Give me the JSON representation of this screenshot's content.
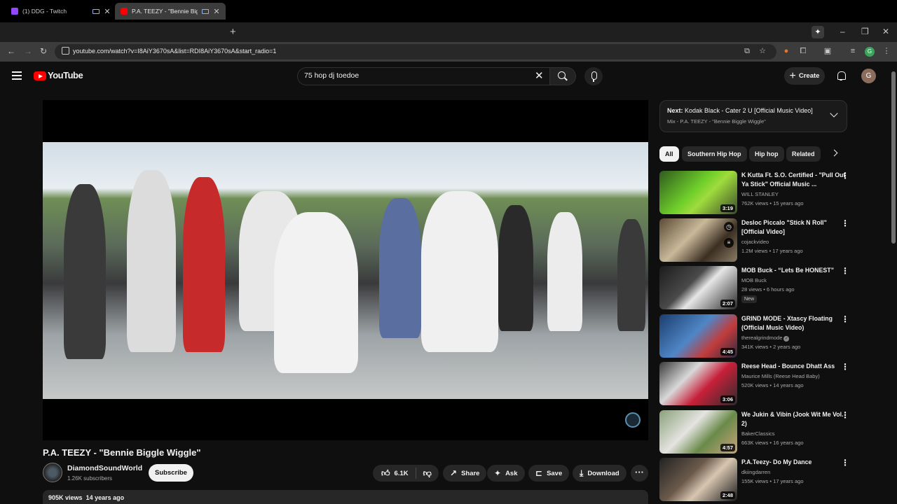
{
  "browser": {
    "tabs": [
      {
        "label": "(1) DDG - Twitch",
        "favicon_color": "#9146ff",
        "active": false
      },
      {
        "label": "P.A. TEEZY - \"Bennie Biggle",
        "favicon_color": "#ff0000",
        "active": true
      }
    ],
    "url": "youtube.com/watch?v=I8AiY3670sA&list=RDI8AiY3670sA&start_radio=1",
    "profile_initial": "G"
  },
  "youtube": {
    "logo_text": "YouTube",
    "search_query": "75 hop dj toedoe",
    "create_label": "Create",
    "user_initial": "G"
  },
  "video": {
    "title": "P.A. TEEZY - \"Bennie Biggle Wiggle\"",
    "channel": "DiamondSoundWorld",
    "subscribers": "1.26K subscribers",
    "subscribe_label": "Subscribe",
    "likes": "6.1K",
    "share_label": "Share",
    "ask_label": "Ask",
    "save_label": "Save",
    "download_label": "Download",
    "views": "905K views",
    "age": "14 years ago"
  },
  "up_next": {
    "label": "Next:",
    "title": "Kodak Black - Cater 2 U [Official Music Video]",
    "subtitle": "Mix - P.A. TEEZY - \"Bennie Biggle Wiggle\""
  },
  "chips": [
    "All",
    "Southern Hip Hop",
    "Hip hop",
    "Related"
  ],
  "recommendations": [
    {
      "title": "K Kutta Ft. S.O. Certified - \"Pull Out Ya Stick\" Official Music ...",
      "channel": "WILL STANLEY",
      "stats": "762K views • 15 years ago",
      "duration": "3:19",
      "thumb": "linear-gradient(135deg,#2f5a1e,#6fcf2a 45%,#9fdc3c 60%,#3a4a2a)"
    },
    {
      "title": "Desloc Piccalo \"Stick N Roll\" [Official Video]",
      "channel": "cojackvideo",
      "stats": "1.2M views • 17 years ago",
      "duration": "",
      "thumb": "linear-gradient(135deg,#5a4a34,#c9b99a 40%,#3b2f22 70%,#8a7d66)"
    },
    {
      "title": "MOB Buck - “Lets Be HONEST”",
      "channel": "MOB Buck",
      "stats": "28 views • 6 hours ago",
      "duration": "2:07",
      "badge": "New",
      "thumb": "linear-gradient(135deg,#1b1b1b,#4a4a4a 40%,#e6e6e6 55%,#2a2a2a)"
    },
    {
      "title": "GRIND MODE - Xtascy Floating (Official Music Video)",
      "channel": "therealgrindmode",
      "stats": "341K views • 2 years ago",
      "duration": "4:45",
      "thumb": "linear-gradient(135deg,#1b3d6d,#4f86c6 45%,#c23b3b 70%,#2a2a40)"
    },
    {
      "title": "Reese Head - Bounce Dhatt Ass",
      "channel": "Maurice Mills (Reese Head Baby)",
      "stats": "520K views • 14 years ago",
      "duration": "3:06",
      "thumb": "linear-gradient(135deg,#3a3a3a,#d8d8d8 35%,#c8203a 60%,#2b2b2b)"
    },
    {
      "title": "We Jukin & Vibin (Jook Wit Me Vol. 2)",
      "channel": "BakerClassics",
      "stats": "663K views • 16 years ago",
      "duration": "4:57",
      "thumb": "linear-gradient(135deg,#8aa07a,#e4e4e0 40%,#6a8a4a 65%,#c9a37a)"
    },
    {
      "title": "P.A.Teezy- Do My Dance",
      "channel": "dkiingdarren",
      "stats": "155K views • 17 years ago",
      "duration": "2:48",
      "thumb": "linear-gradient(135deg,#222,#6b5a4b 40%,#d7c6b0 60%,#1a1a1a)"
    }
  ]
}
